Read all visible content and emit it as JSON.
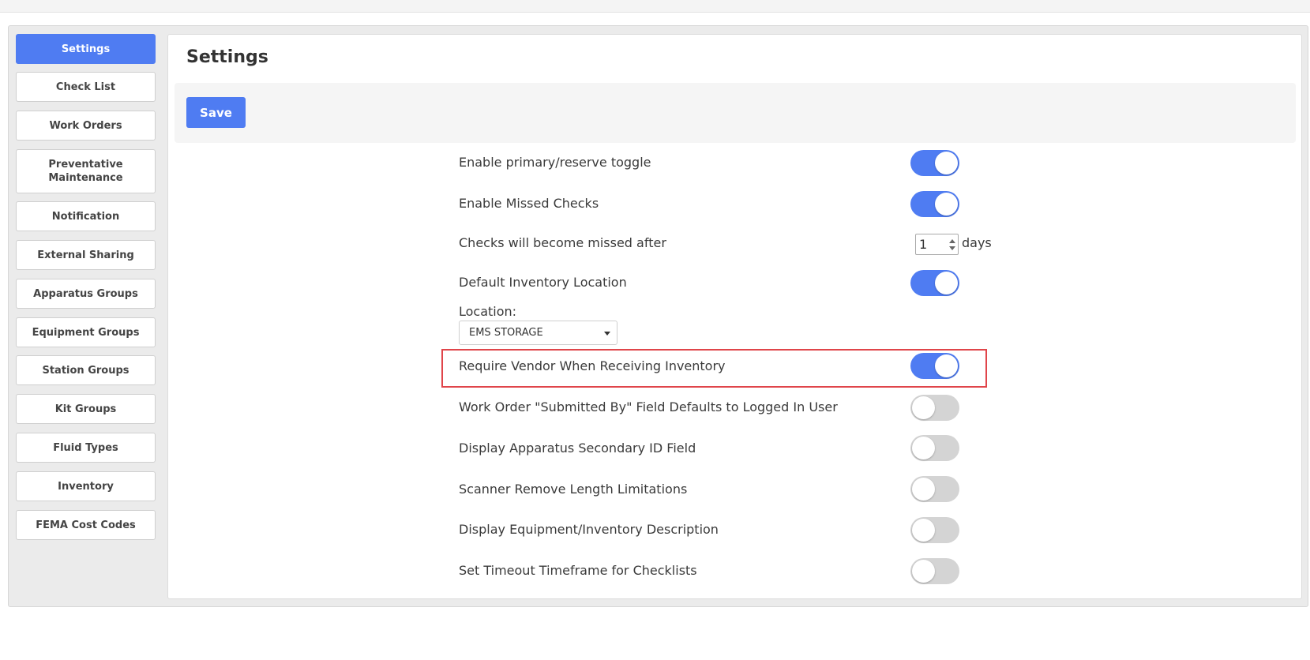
{
  "sidebar": {
    "items": [
      {
        "label": "Settings",
        "active": true
      },
      {
        "label": "Check List",
        "active": false
      },
      {
        "label": "Work Orders",
        "active": false
      },
      {
        "label": "Preventative Maintenance",
        "active": false
      },
      {
        "label": "Notification",
        "active": false
      },
      {
        "label": "External Sharing",
        "active": false
      },
      {
        "label": "Apparatus Groups",
        "active": false
      },
      {
        "label": "Equipment Groups",
        "active": false
      },
      {
        "label": "Station Groups",
        "active": false
      },
      {
        "label": "Kit Groups",
        "active": false
      },
      {
        "label": "Fluid Types",
        "active": false
      },
      {
        "label": "Inventory",
        "active": false
      },
      {
        "label": "FEMA Cost Codes",
        "active": false
      }
    ]
  },
  "main": {
    "title": "Settings",
    "save_label": "Save",
    "settings": [
      {
        "label": "Enable primary/reserve toggle",
        "enabled": true
      },
      {
        "label": "Enable Missed Checks",
        "enabled": true
      },
      {
        "label": "Checks will become missed after",
        "value": "1",
        "unit": "days"
      },
      {
        "label": "Default Inventory Location",
        "enabled": true
      },
      {
        "label": "Require Vendor When Receiving Inventory",
        "enabled": true,
        "highlighted": true
      },
      {
        "label": "Work Order \"Submitted By\" Field Defaults to Logged In User",
        "enabled": false
      },
      {
        "label": "Display Apparatus Secondary ID Field",
        "enabled": false
      },
      {
        "label": "Scanner Remove Length Limitations",
        "enabled": false
      },
      {
        "label": "Display Equipment/Inventory Description",
        "enabled": false
      },
      {
        "label": "Set Timeout Timeframe for Checklists",
        "enabled": false
      }
    ],
    "location": {
      "label": "Location:",
      "selected": "EMS STORAGE"
    }
  },
  "colors": {
    "accent": "#4f7cf2",
    "toggle_off": "#d4d4d4",
    "highlight_border": "#e0454a"
  }
}
